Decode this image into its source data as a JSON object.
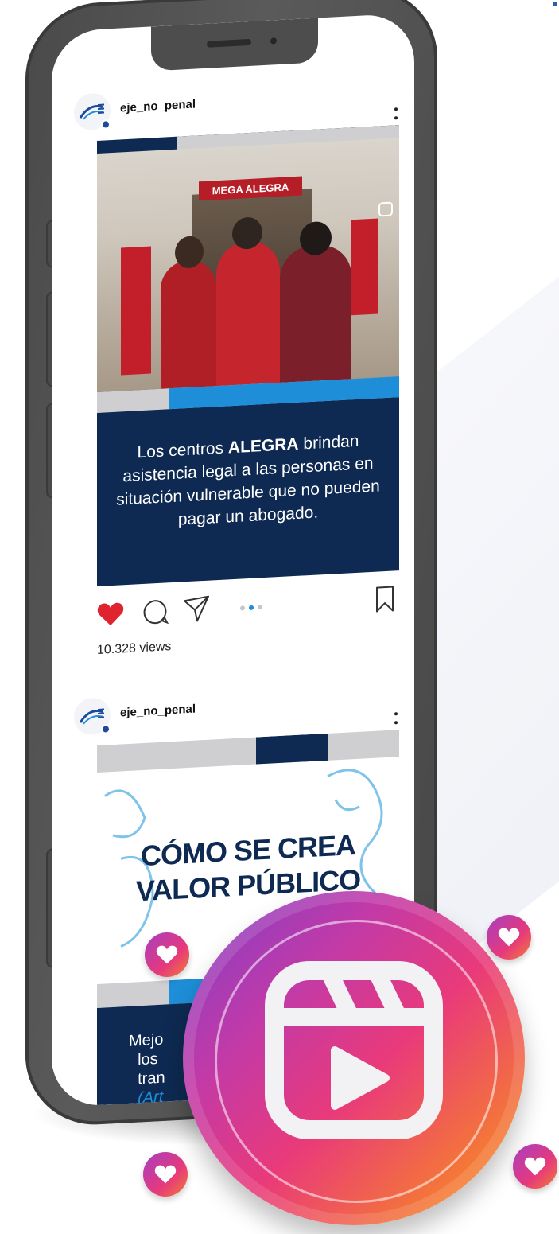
{
  "post1": {
    "username": "eje_no_penal",
    "sign_text": "MEGA ALEGRA",
    "caption_parts": {
      "before": "Los centros ",
      "bold": "ALEGRA",
      "after": " brindan asistencia legal a las personas en situación vulnerable que no pueden pagar un abogado."
    },
    "views": "10.328 views",
    "carousel": {
      "count": 3,
      "active_index": 1
    }
  },
  "post2": {
    "username": "eje_no_penal",
    "title_line1": "CÓMO SE CREA",
    "title_line2": "VALOR PÚBLICO",
    "caption_line1": "Mejo",
    "caption_line2": "  los",
    "caption_line3": "  tran",
    "caption_link": "  (Art"
  },
  "colors": {
    "navy": "#0e2a52",
    "accent_blue": "#1e8ed8",
    "like_red": "#e0242f",
    "phone_frame": "#4a4a4a"
  },
  "icons": [
    "heart-icon",
    "comment-icon",
    "share-icon",
    "bookmark-icon",
    "more-icon",
    "reels-icon"
  ]
}
